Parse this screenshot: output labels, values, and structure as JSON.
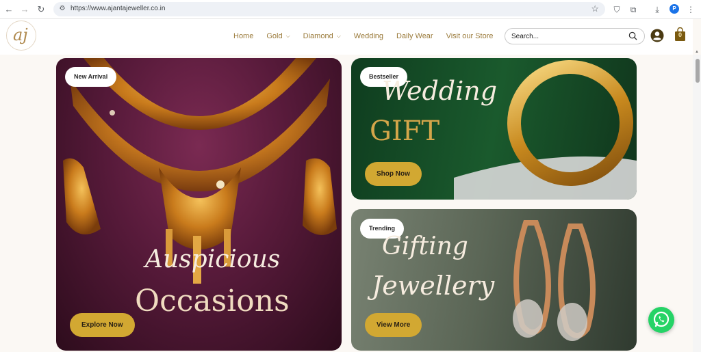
{
  "browser": {
    "url": "https://www.ajantajeweller.co.in",
    "profile_initial": "P"
  },
  "site": {
    "logo_text": "aj",
    "menu": [
      {
        "label": "Home",
        "has_dropdown": false
      },
      {
        "label": "Gold",
        "has_dropdown": true
      },
      {
        "label": "Diamond",
        "has_dropdown": true
      },
      {
        "label": "Wedding",
        "has_dropdown": false
      },
      {
        "label": "Daily Wear",
        "has_dropdown": false
      },
      {
        "label": "Visit our Store",
        "has_dropdown": false
      }
    ],
    "search_placeholder": "Search...",
    "cart_count": "0"
  },
  "banners": {
    "main": {
      "badge": "New Arrival",
      "script_line": "Auspicious",
      "serif_line": "Occasions",
      "cta": "Explore Now"
    },
    "wedding": {
      "badge": "Bestseller",
      "script_line": "Wedding",
      "serif_line": "GIFT",
      "cta": "Shop Now"
    },
    "gifting": {
      "badge": "Trending",
      "script_line_1": "Gifting",
      "script_line_2": "Jewellery",
      "cta": "View More"
    }
  },
  "colors": {
    "accent_gold": "#d2a832",
    "menu_text": "#9a7a3a",
    "whatsapp": "#25d366"
  }
}
